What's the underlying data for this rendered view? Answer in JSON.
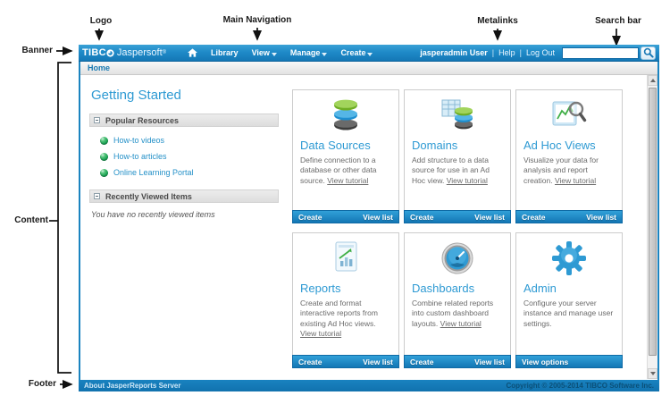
{
  "annotations": {
    "logo": "Logo",
    "main_navigation": "Main Navigation",
    "metalinks": "Metalinks",
    "search_bar": "Search bar",
    "banner": "Banner",
    "content": "Content",
    "footer": "Footer"
  },
  "banner": {
    "logo_tibco": "TIBC",
    "logo_product": "Jaspersoft",
    "logo_trademark": "®",
    "nav": [
      {
        "label": "Library",
        "has_dropdown": false
      },
      {
        "label": "View",
        "has_dropdown": true
      },
      {
        "label": "Manage",
        "has_dropdown": true
      },
      {
        "label": "Create",
        "has_dropdown": true
      }
    ],
    "user": "jasperadmin User",
    "separator": "|",
    "metalinks": [
      "Help",
      "Log Out"
    ],
    "search": {
      "value": "",
      "icon": "search-icon"
    }
  },
  "breadcrumb": "Home",
  "content": {
    "title": "Getting Started",
    "sections": [
      {
        "title": "Popular Resources",
        "links": [
          "How-to videos",
          "How-to articles",
          "Online Learning Portal"
        ]
      },
      {
        "title": "Recently Viewed Items",
        "note": "You have no recently viewed items"
      }
    ],
    "cards": [
      {
        "title": "Data Sources",
        "description": "Define connection to a database or other data source.",
        "tutorial_link": "View tutorial",
        "icon": "data-sources-icon",
        "actions": [
          "Create",
          "View list"
        ]
      },
      {
        "title": "Domains",
        "description": "Add structure to a data source for use in an Ad Hoc view.",
        "tutorial_link": "View tutorial",
        "icon": "domains-icon",
        "actions": [
          "Create",
          "View list"
        ]
      },
      {
        "title": "Ad Hoc Views",
        "description": "Visualize your data for analysis and report creation.",
        "tutorial_link": "View tutorial",
        "icon": "adhoc-views-icon",
        "actions": [
          "Create",
          "View list"
        ]
      },
      {
        "title": "Reports",
        "description": "Create and format interactive reports from existing Ad Hoc views.",
        "tutorial_link": "View tutorial",
        "icon": "reports-icon",
        "actions": [
          "Create",
          "View list"
        ]
      },
      {
        "title": "Dashboards",
        "description": "Combine related reports into custom dashboard layouts.",
        "tutorial_link": "View tutorial",
        "icon": "dashboards-icon",
        "actions": [
          "Create",
          "View list"
        ]
      },
      {
        "title": "Admin",
        "description": "Configure your server instance and manage user settings.",
        "tutorial_link": "",
        "icon": "admin-gear-icon",
        "actions": [
          "View options"
        ]
      }
    ]
  },
  "footer": {
    "left": "About JasperReports Server",
    "right": "Copyright © 2005-2014 TIBCO Software Inc."
  },
  "colors": {
    "banner_blue": "#1f8ac8",
    "frame_border_blue": "#1b84c0",
    "card_title_blue": "#2e9ad3",
    "link_blue": "#2591c8",
    "footer_blue": "#1478b4"
  }
}
